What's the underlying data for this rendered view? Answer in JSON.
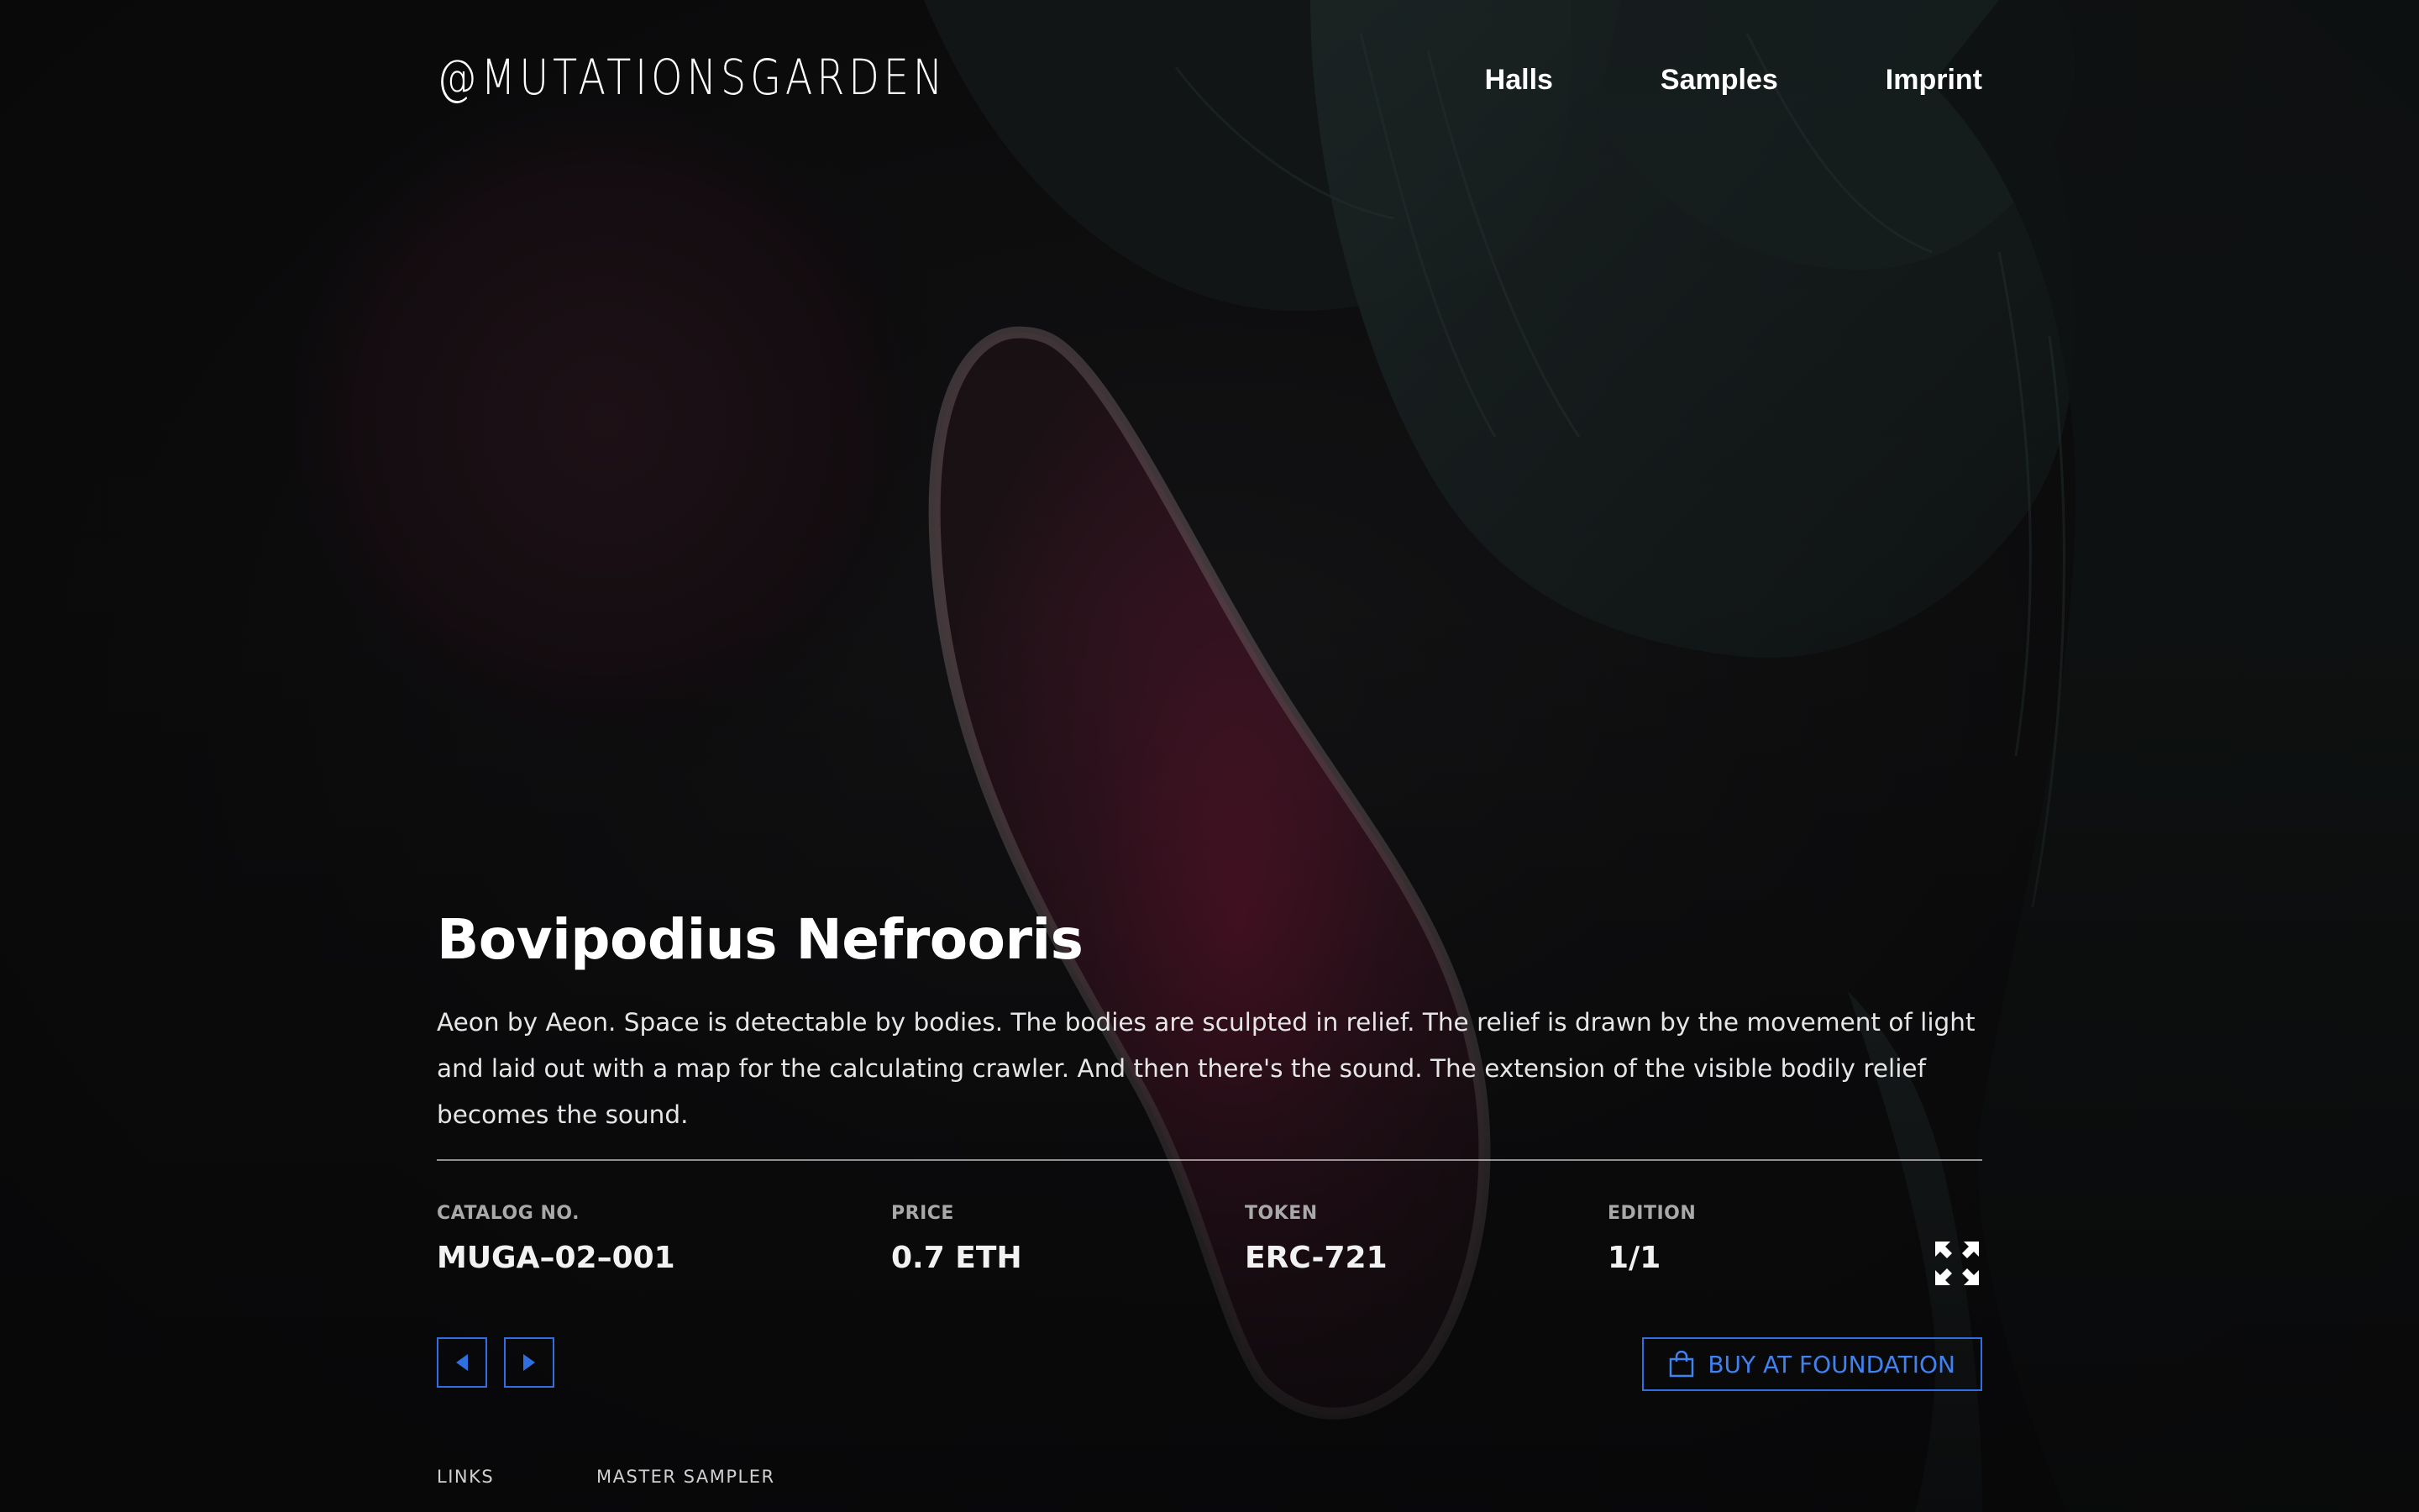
{
  "header": {
    "brand": "@MUTATIONSGARDEN",
    "nav": [
      {
        "label": "Halls"
      },
      {
        "label": "Samples"
      },
      {
        "label": "Imprint"
      }
    ]
  },
  "artwork": {
    "title": "Bovipodius Nefrooris",
    "description": "Aeon by Aeon. Space is detectable by bodies. The bodies are sculpted in relief. The relief is drawn by the movement of light and laid out with a map for the calculating crawler. And then there's the sound. The extension of the visible bodily relief becomes the sound."
  },
  "meta": {
    "catalog": {
      "label": "CATALOG NO.",
      "value": "MUGA–02–001"
    },
    "price": {
      "label": "PRICE",
      "value": "0.7 ETH"
    },
    "token": {
      "label": "TOKEN",
      "value": "ERC-721"
    },
    "edition": {
      "label": "EDITION",
      "value": "1/1"
    }
  },
  "actions": {
    "buy_label": "BUY AT FOUNDATION",
    "prev_icon": "caret-left-icon",
    "next_icon": "caret-right-icon",
    "fullscreen_icon": "expand-icon",
    "buy_icon": "shopping-bag-icon"
  },
  "footer": {
    "links_label": "LINKS",
    "master_sampler_label": "MASTER SAMPLER"
  },
  "colors": {
    "accent": "#2f6fe0",
    "background": "#0b0b0c",
    "text": "#ffffff"
  }
}
